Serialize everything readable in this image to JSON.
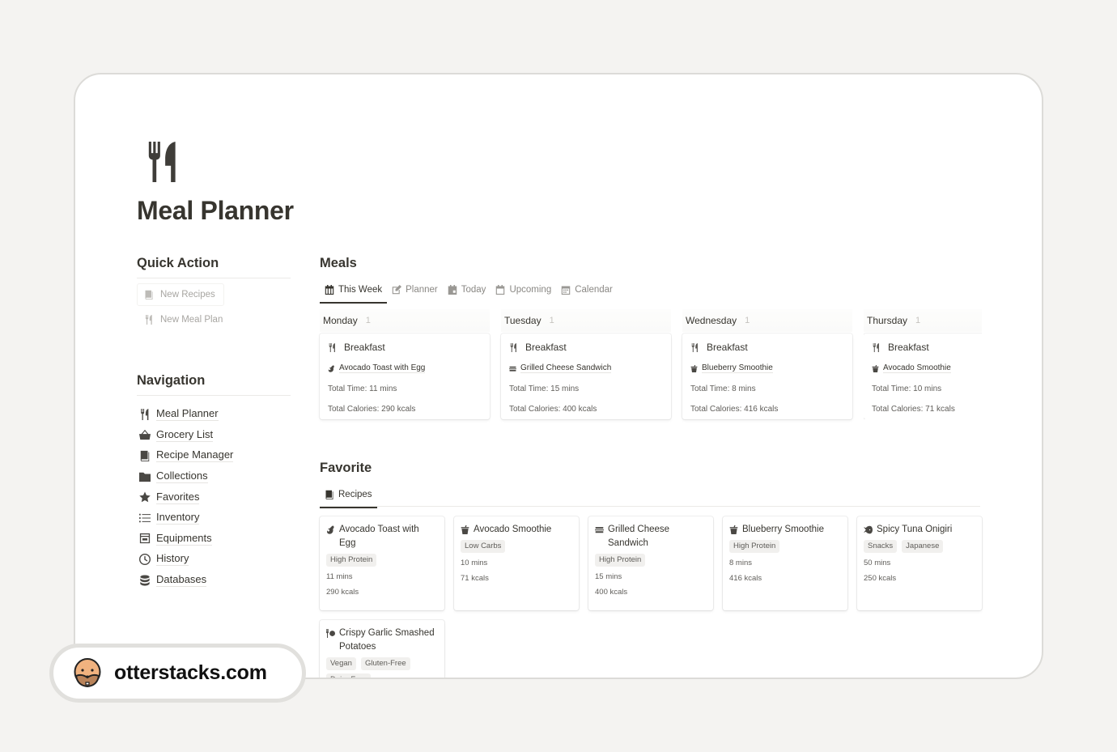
{
  "page": {
    "title": "Meal Planner",
    "icon": "fork-knife-icon"
  },
  "quick_action": {
    "heading": "Quick Action",
    "items": [
      {
        "label": "New Recipes",
        "icon": "book-icon"
      },
      {
        "label": "New Meal Plan",
        "icon": "fork-knife-icon"
      }
    ]
  },
  "navigation": {
    "heading": "Navigation",
    "items": [
      {
        "label": "Meal Planner",
        "icon": "fork-knife-icon"
      },
      {
        "label": "Grocery List",
        "icon": "basket-icon"
      },
      {
        "label": "Recipe Manager",
        "icon": "book-icon"
      },
      {
        "label": "Collections",
        "icon": "folder-icon"
      },
      {
        "label": "Favorites",
        "icon": "star-icon"
      },
      {
        "label": "Inventory",
        "icon": "list-icon"
      },
      {
        "label": "Equipments",
        "icon": "oven-icon"
      },
      {
        "label": "History",
        "icon": "clock-icon"
      },
      {
        "label": "Databases",
        "icon": "database-icon"
      }
    ]
  },
  "meals": {
    "heading": "Meals",
    "tabs": [
      {
        "label": "This Week",
        "icon": "calendar-week-icon",
        "active": true
      },
      {
        "label": "Planner",
        "icon": "edit-icon",
        "active": false
      },
      {
        "label": "Today",
        "icon": "calendar-today-icon",
        "active": false
      },
      {
        "label": "Upcoming",
        "icon": "calendar-icon",
        "active": false
      },
      {
        "label": "Calendar",
        "icon": "calendar-grid-icon",
        "active": false
      }
    ],
    "columns": [
      {
        "day": "Monday",
        "count": "1",
        "card": {
          "meal_type": "Breakfast",
          "recipe": "Avocado Toast with Egg",
          "recipe_icon": "avocado-icon",
          "time": "Total Time: 11 mins",
          "calories": "Total Calories: 290 kcals"
        }
      },
      {
        "day": "Tuesday",
        "count": "1",
        "card": {
          "meal_type": "Breakfast",
          "recipe": "Grilled Cheese Sandwich",
          "recipe_icon": "sandwich-icon",
          "time": "Total Time: 15 mins",
          "calories": "Total Calories: 400 kcals"
        }
      },
      {
        "day": "Wednesday",
        "count": "1",
        "card": {
          "meal_type": "Breakfast",
          "recipe": "Blueberry Smoothie",
          "recipe_icon": "smoothie-icon",
          "time": "Total Time: 8 mins",
          "calories": "Total Calories: 416 kcals"
        }
      },
      {
        "day": "Thursday",
        "count": "1",
        "card": {
          "meal_type": "Breakfast",
          "recipe": "Avocado Smoothie",
          "recipe_icon": "smoothie-icon",
          "time": "Total Time: 10 mins",
          "calories": "Total Calories: 71 kcals"
        }
      }
    ]
  },
  "favorite": {
    "heading": "Favorite",
    "tabs": [
      {
        "label": "Recipes",
        "icon": "book-icon",
        "active": true
      }
    ],
    "cards": [
      {
        "title": "Avocado Toast with Egg",
        "icon": "avocado-icon",
        "tags": [
          "High Protein"
        ],
        "time": "11 mins",
        "calories": "290 kcals"
      },
      {
        "title": "Avocado Smoothie",
        "icon": "smoothie-icon",
        "tags": [
          "Low Carbs"
        ],
        "time": "10 mins",
        "calories": "71 kcals"
      },
      {
        "title": "Grilled Cheese Sandwich",
        "icon": "sandwich-icon",
        "tags": [
          "High Protein"
        ],
        "time": "15 mins",
        "calories": "400 kcals"
      },
      {
        "title": "Blueberry Smoothie",
        "icon": "smoothie-icon",
        "tags": [
          "High Protein"
        ],
        "time": "8 mins",
        "calories": "416 kcals"
      },
      {
        "title": "Spicy Tuna Onigiri",
        "icon": "fish-icon",
        "tags": [
          "Snacks",
          "Japanese"
        ],
        "time": "50 mins",
        "calories": "250 kcals"
      },
      {
        "title": "Crispy Garlic Smashed Potatoes",
        "icon": "plate-icon",
        "tags": [
          "Vegan",
          "Gluten-Free",
          "Dairy-Free"
        ],
        "time": "",
        "calories": ""
      }
    ]
  },
  "badge": {
    "text": "otterstacks.com",
    "icon": "otter-logo-icon"
  }
}
